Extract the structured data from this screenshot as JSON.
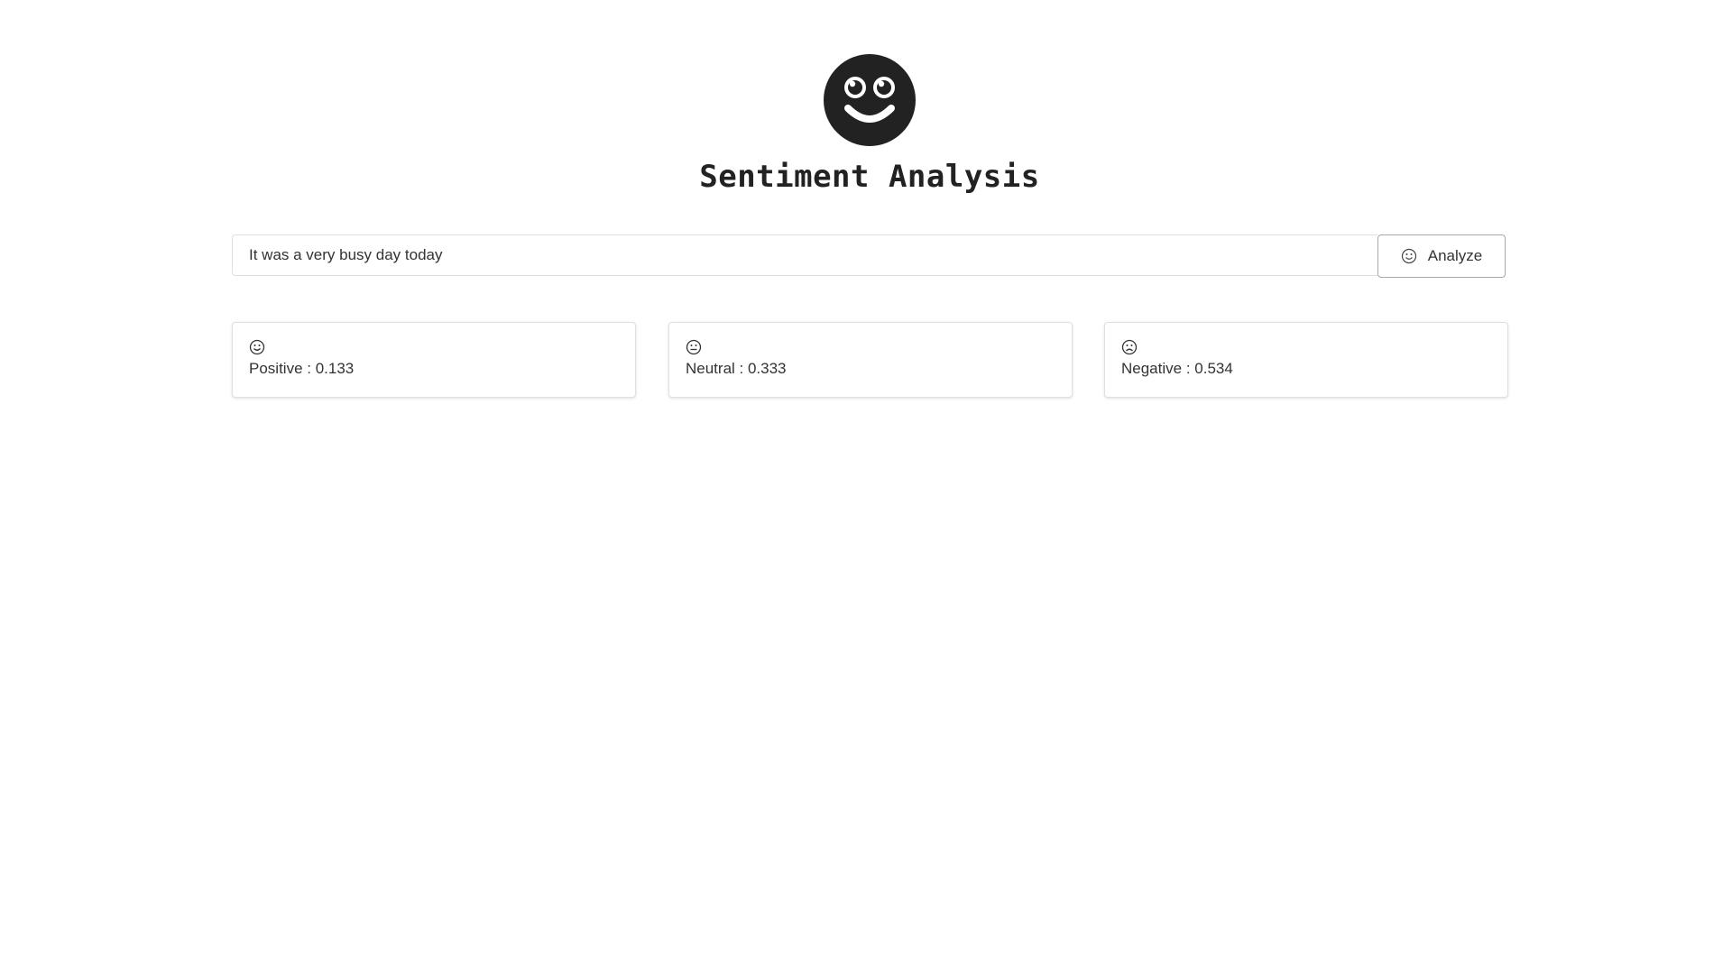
{
  "header": {
    "logo_icon": "smiley-face-icon",
    "title": "Sentiment Analysis"
  },
  "search": {
    "value": "It was a very busy day today",
    "button_label": "Analyze",
    "button_icon": "smile-icon"
  },
  "results": [
    {
      "icon": "smile-icon",
      "label": "Positive : 0.133"
    },
    {
      "icon": "neutral-face-icon",
      "label": "Neutral : 0.333"
    },
    {
      "icon": "frown-icon",
      "label": "Negative : 0.534"
    }
  ],
  "colors": {
    "logo": "#222222",
    "text": "#333333",
    "border": "#dededf"
  }
}
